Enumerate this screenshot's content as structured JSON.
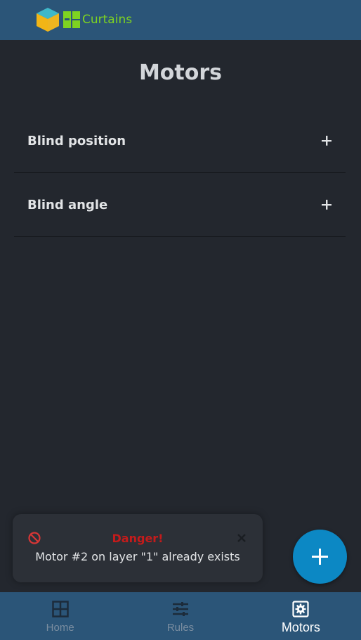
{
  "header": {
    "brand": "Curtains"
  },
  "page": {
    "title": "Motors"
  },
  "motors": [
    {
      "label": "Blind position"
    },
    {
      "label": "Blind angle"
    }
  ],
  "toast": {
    "title": "Danger!",
    "message": "Motor #2 on layer \"1\" already exists"
  },
  "nav": {
    "items": [
      {
        "label": "Home",
        "icon": "grid-icon",
        "active": false
      },
      {
        "label": "Rules",
        "icon": "sliders-icon",
        "active": false
      },
      {
        "label": "Motors",
        "icon": "gear-icon",
        "active": true
      }
    ]
  },
  "colors": {
    "header_bg": "#2b5578",
    "page_bg": "#23272e",
    "brand": "#7ed321",
    "danger": "#c41b1b",
    "fab": "#0c88c4"
  }
}
